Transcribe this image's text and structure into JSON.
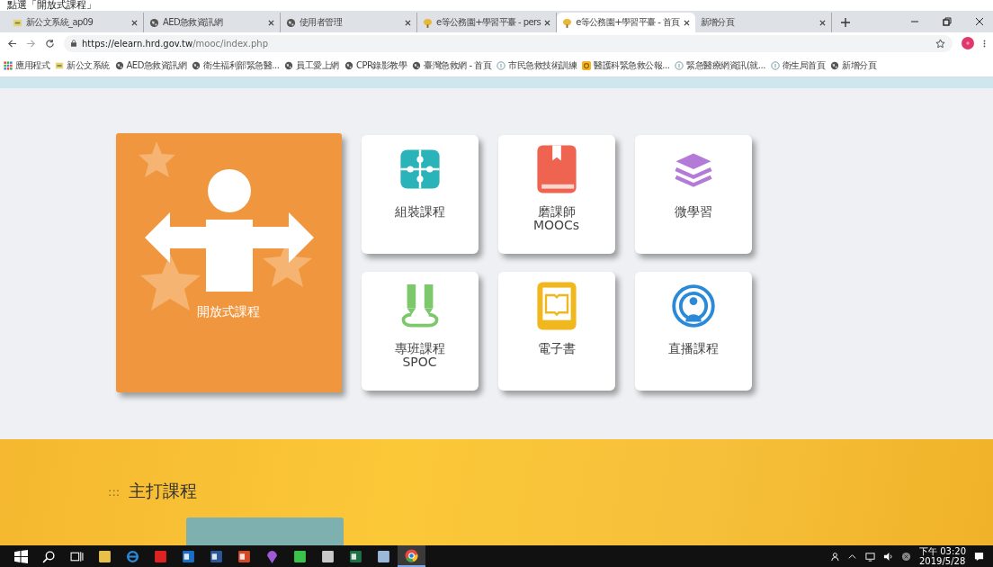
{
  "caption": "點選「開放式課程」",
  "tabs": [
    {
      "label": "新公文系統_ap09",
      "kind": "doc",
      "selected": false
    },
    {
      "label": "AED急救資訊網",
      "kind": "globe",
      "selected": false
    },
    {
      "label": "使用者管理",
      "kind": "globe",
      "selected": false
    },
    {
      "label": "e等公務園+學習平臺 - pers",
      "kind": "elearn",
      "selected": false
    },
    {
      "label": "e等公務園+學習平臺 - 首頁",
      "kind": "elearn",
      "selected": true
    },
    {
      "label": "新增分頁",
      "kind": "none",
      "selected": false
    }
  ],
  "address_bar": {
    "url_host": "https://elearn.hrd.gov.tw",
    "url_path": "/mooc/index.php"
  },
  "bookmarks": [
    {
      "label": "應用程式",
      "kind": "apps"
    },
    {
      "label": "新公文系統",
      "kind": "doc"
    },
    {
      "label": "AED急救資訊網",
      "kind": "globe"
    },
    {
      "label": "衛生福利部緊急醫...",
      "kind": "globe"
    },
    {
      "label": "員工愛上網",
      "kind": "globe"
    },
    {
      "label": "CPR錄影教學",
      "kind": "globe"
    },
    {
      "label": "臺灣急救網 - 首頁",
      "kind": "globe"
    },
    {
      "label": "市民急救技術訓練",
      "kind": "info"
    },
    {
      "label": "醫護科緊急救公報...",
      "kind": "badge"
    },
    {
      "label": "緊急醫療網資訊(就...",
      "kind": "info"
    },
    {
      "label": "衛生局首頁",
      "kind": "info"
    },
    {
      "label": "新增分頁",
      "kind": "globe"
    }
  ],
  "featured": {
    "label": "開放式課程"
  },
  "cards": [
    {
      "lines": [
        "組裝課程"
      ],
      "kind": "puzzle"
    },
    {
      "lines": [
        "磨課師",
        "MOOCs"
      ],
      "kind": "book"
    },
    {
      "lines": [
        "微學習"
      ],
      "kind": "layers"
    },
    {
      "lines": [
        "專班課程",
        "SPOC"
      ],
      "kind": "pencils"
    },
    {
      "lines": [
        "電子書"
      ],
      "kind": "ebook"
    },
    {
      "lines": [
        "直播課程"
      ],
      "kind": "broadcast"
    }
  ],
  "section": {
    "marker": ":::",
    "title": "主打課程"
  },
  "taskbar": {
    "apps": [
      {
        "kind": "start",
        "selected": false
      },
      {
        "kind": "search",
        "selected": false
      },
      {
        "kind": "taskview",
        "selected": false
      },
      {
        "kind": "folder",
        "selected": false
      },
      {
        "kind": "ie",
        "selected": false
      },
      {
        "kind": "pdf",
        "selected": false
      },
      {
        "kind": "outlook",
        "selected": false
      },
      {
        "kind": "word",
        "selected": false
      },
      {
        "kind": "ppt",
        "selected": false
      },
      {
        "kind": "pin",
        "selected": false
      },
      {
        "kind": "chat",
        "selected": false
      },
      {
        "kind": "paint",
        "selected": false
      },
      {
        "kind": "excel",
        "selected": false
      },
      {
        "kind": "note",
        "selected": false
      },
      {
        "kind": "chrome",
        "selected": true
      }
    ],
    "time": "下午 03:20",
    "date": "2019/5/28"
  }
}
